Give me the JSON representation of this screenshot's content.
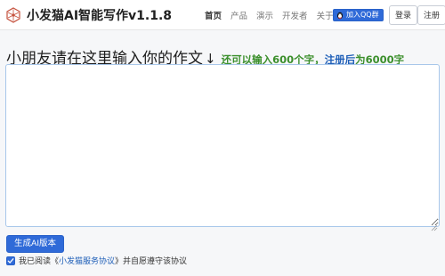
{
  "header": {
    "app_title": "小发猫AI智能写作v1.1.8",
    "nav": [
      {
        "label": "首页",
        "active": true
      },
      {
        "label": "产品",
        "active": false
      },
      {
        "label": "演示",
        "active": false
      },
      {
        "label": "开发者",
        "active": false
      },
      {
        "label": "关于",
        "active": false
      }
    ],
    "qq_group_label": "加入QQ群",
    "login_label": "登录",
    "register_label": "注册"
  },
  "main": {
    "heading": "小朋友请在这里输入你的作文",
    "arrow": "↓",
    "hint_part1": "还可以输入600个字，",
    "hint_part2": "注册后",
    "hint_part3": "为6000字",
    "editor_value": "",
    "generate_button_label": "生成AI版本",
    "agreement_prefix": "我已阅读《",
    "agreement_link": "小发猫服务协议",
    "agreement_suffix": "》并自愿遵守该协议",
    "agreement_checked": true
  },
  "colors": {
    "accent": "#2f6ad8",
    "hint_green": "#3b8f2c",
    "hint_blue": "#1f5fb8",
    "editor_border": "#a8c7ea"
  },
  "icons": {
    "logo": "hexagon-network-logo-icon",
    "qq": "qq-penguin-icon",
    "check": "check-icon",
    "resize": "resize-grip-icon"
  }
}
